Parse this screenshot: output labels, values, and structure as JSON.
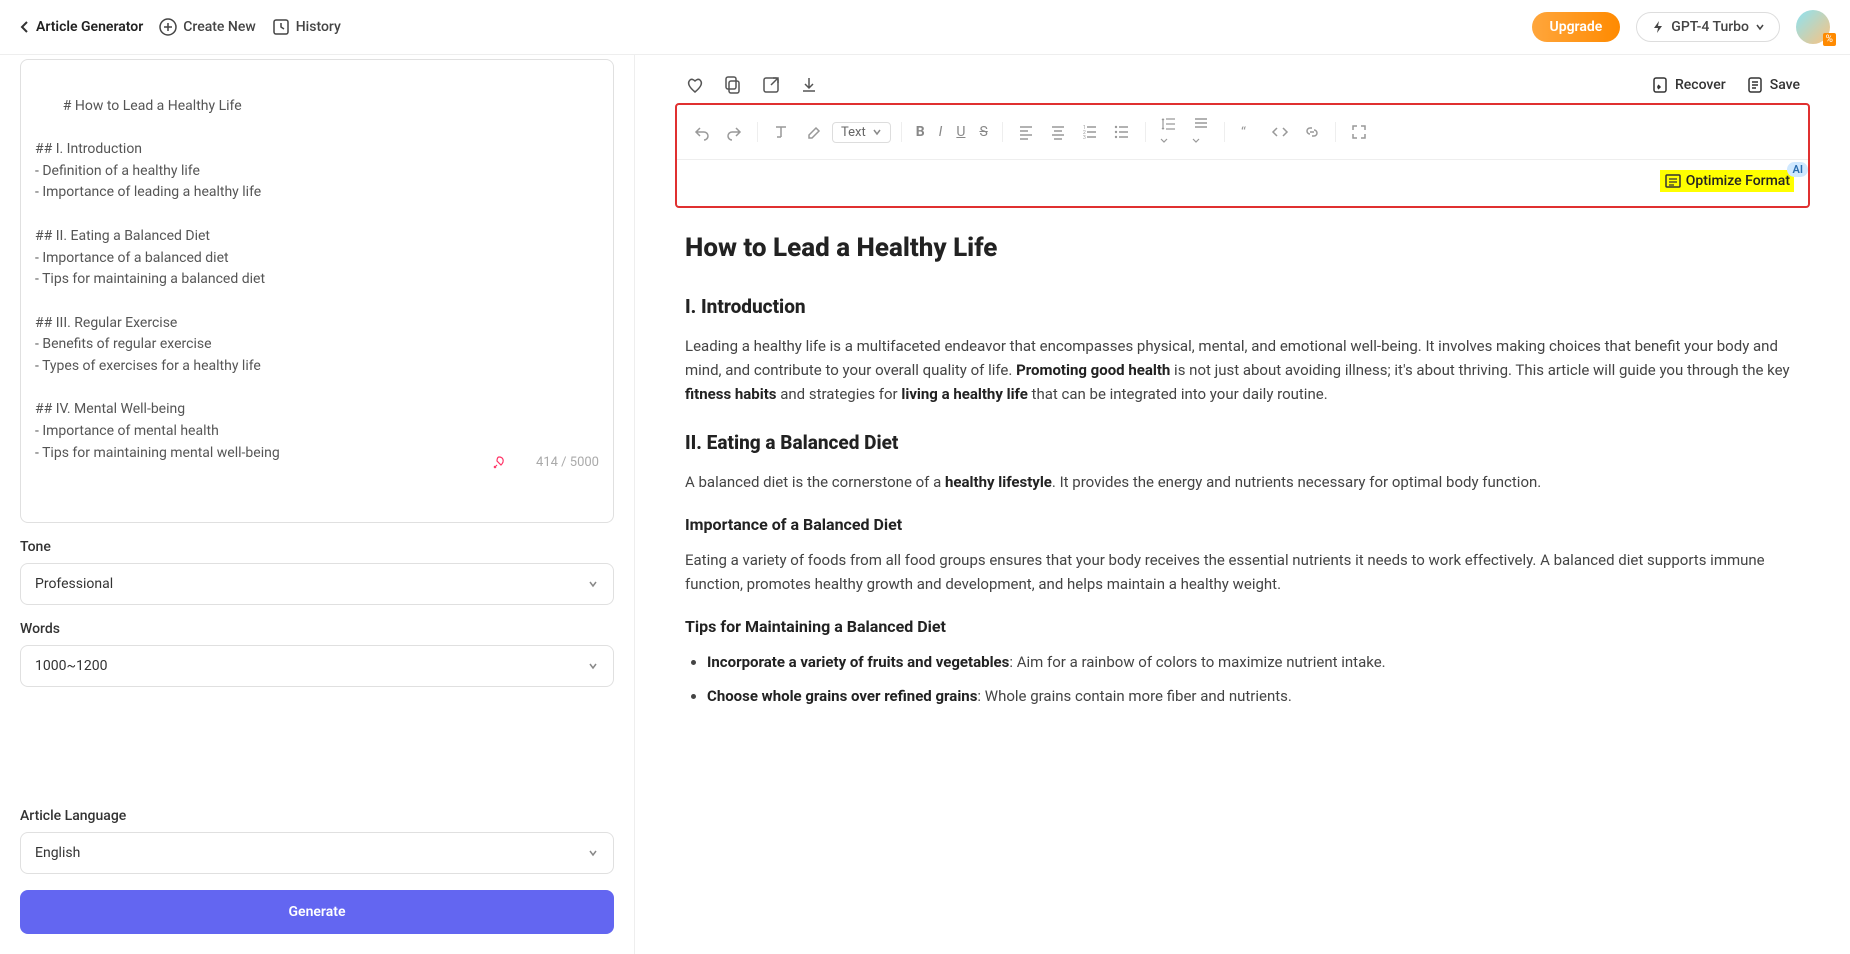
{
  "header": {
    "title": "Article Generator",
    "create_new": "Create New",
    "history": "History",
    "upgrade": "Upgrade",
    "model": "GPT-4 Turbo",
    "avatar_badge": "%"
  },
  "left": {
    "outline": "# How to Lead a Healthy Life\n\n## I. Introduction\n- Definition of a healthy life\n- Importance of leading a healthy life\n\n## II. Eating a Balanced Diet\n- Importance of a balanced diet\n- Tips for maintaining a balanced diet\n\n## III. Regular Exercise\n- Benefits of regular exercise\n- Types of exercises for a healthy life\n\n## IV. Mental Well-being\n- Importance of mental health\n- Tips for maintaining mental well-being",
    "char_count": "414 / 5000",
    "tone_label": "Tone",
    "tone_value": "Professional",
    "words_label": "Words",
    "words_value": "1000~1200",
    "lang_label": "Article Language",
    "lang_value": "English",
    "generate": "Generate"
  },
  "right": {
    "recover": "Recover",
    "save": "Save",
    "text_dropdown": "Text",
    "optimize": "Optimize Format",
    "ai_badge": "AI"
  },
  "article": {
    "h1": "How to Lead a Healthy Life",
    "s1_h2": "I. Introduction",
    "s1_p1a": "Leading a healthy life is a multifaceted endeavor that encompasses physical, mental, and emotional well-being. It involves making choices that benefit your body and mind, and contribute to your overall quality of life. ",
    "s1_b1": "Promoting good health",
    "s1_p1b": " is not just about avoiding illness; it's about thriving. This article will guide you through the key ",
    "s1_b2": "fitness habits",
    "s1_p1c": " and strategies for ",
    "s1_b3": "living a healthy life",
    "s1_p1d": " that can be integrated into your daily routine.",
    "s2_h2": "II. Eating a Balanced Diet",
    "s2_p1a": "A balanced diet is the cornerstone of a ",
    "s2_b1": "healthy lifestyle",
    "s2_p1b": ". It provides the energy and nutrients necessary for optimal body function.",
    "s2_h3a": "Importance of a Balanced Diet",
    "s2_p2": "Eating a variety of foods from all food groups ensures that your body receives the essential nutrients it needs to work effectively. A balanced diet supports immune function, promotes healthy growth and development, and helps maintain a healthy weight.",
    "s2_h3b": "Tips for Maintaining a Balanced Diet",
    "li1_b": "Incorporate a variety of fruits and vegetables",
    "li1_t": ": Aim for a rainbow of colors to maximize nutrient intake.",
    "li2_b": "Choose whole grains over refined grains",
    "li2_t": ": Whole grains contain more fiber and nutrients."
  }
}
